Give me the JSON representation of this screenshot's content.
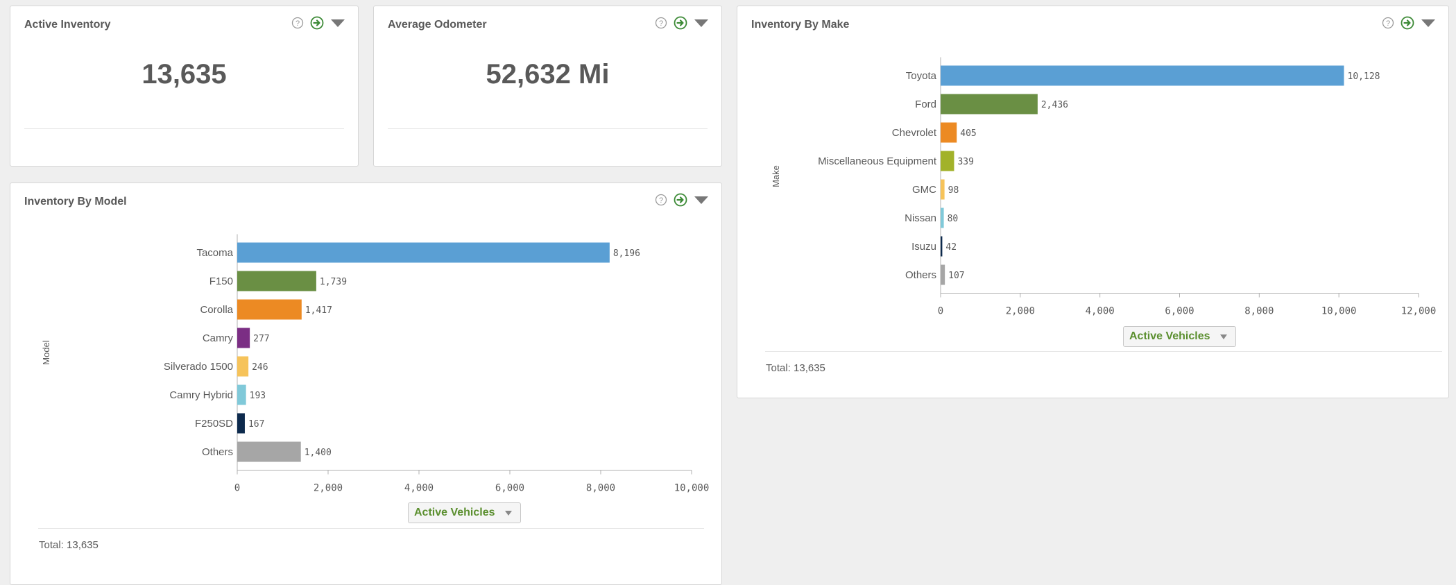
{
  "kpis": {
    "active_inventory": {
      "title": "Active Inventory",
      "value": "13,635"
    },
    "average_odometer": {
      "title": "Average Odometer",
      "value": "52,632 Mi"
    }
  },
  "model_panel": {
    "title": "Inventory By Model",
    "measure_label": "Active Vehicles",
    "total_text": "Total: 13,635"
  },
  "make_panel": {
    "title": "Inventory By Make",
    "measure_label": "Active Vehicles",
    "total_text": "Total: 13,635"
  },
  "chart_data": [
    {
      "id": "model",
      "type": "bar",
      "orientation": "horizontal",
      "title": "Inventory By Model",
      "ylabel": "Model",
      "xlabel": "Active Vehicles",
      "categories": [
        "Tacoma",
        "F150",
        "Corolla",
        "Camry",
        "Silverado 1500",
        "Camry Hybrid",
        "F250SD",
        "Others"
      ],
      "values": [
        8196,
        1739,
        1417,
        277,
        246,
        193,
        167,
        1400
      ],
      "value_labels": [
        "8,196",
        "1,739",
        "1,417",
        "277",
        "246",
        "193",
        "167",
        "1,400"
      ],
      "colors": [
        "#5a9fd4",
        "#6a8f44",
        "#ec8a23",
        "#7b2e84",
        "#f6c35a",
        "#80c9d9",
        "#0d2a4d",
        "#a6a6a6"
      ],
      "xlim": [
        0,
        10000
      ],
      "ticks": [
        0,
        2000,
        4000,
        6000,
        8000,
        10000
      ],
      "tick_labels": [
        "0",
        "2,000",
        "4,000",
        "6,000",
        "8,000",
        "10,000"
      ],
      "grid": false
    },
    {
      "id": "make",
      "type": "bar",
      "orientation": "horizontal",
      "title": "Inventory By Make",
      "ylabel": "Make",
      "xlabel": "Active Vehicles",
      "categories": [
        "Toyota",
        "Ford",
        "Chevrolet",
        "Miscellaneous Equipment",
        "GMC",
        "Nissan",
        "Isuzu",
        "Others"
      ],
      "values": [
        10128,
        2436,
        405,
        339,
        98,
        80,
        42,
        107
      ],
      "value_labels": [
        "10,128",
        "2,436",
        "405",
        "339",
        "98",
        "80",
        "42",
        "107"
      ],
      "colors": [
        "#5a9fd4",
        "#6a8f44",
        "#ec8a23",
        "#a2b22a",
        "#f6c35a",
        "#80c9d9",
        "#0d2a4d",
        "#a6a6a6"
      ],
      "xlim": [
        0,
        12000
      ],
      "ticks": [
        0,
        2000,
        4000,
        6000,
        8000,
        10000,
        12000
      ],
      "tick_labels": [
        "0",
        "2,000",
        "4,000",
        "6,000",
        "8,000",
        "10,000",
        "12,000"
      ],
      "grid": false
    }
  ]
}
